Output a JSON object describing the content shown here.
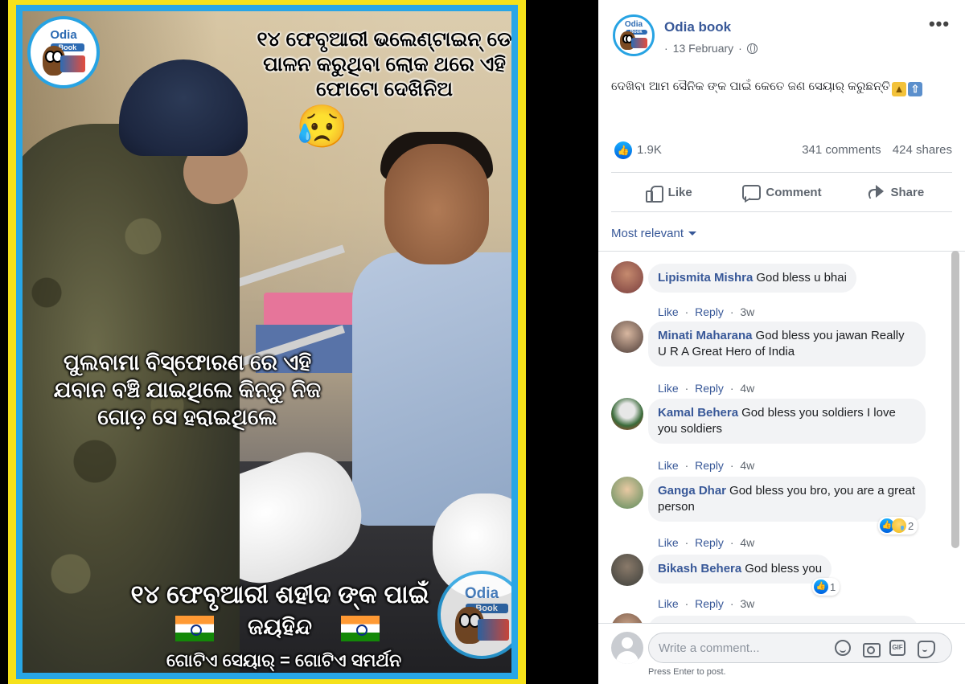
{
  "photo": {
    "top_text": "୧୪ ଫେବୃଆରୀ ଭଲେଣ୍ଟାଇନ୍ ଡେ ପାଳନ କରୁଥିବା ଲୋକ ଥରେ ଏହି ଫୋଟୋ ଦେଖିନିଅ",
    "emoji": "😥",
    "middle_text": "ପୁଲବାମା ବିସ୍ଫୋରଣ ରେ ଏହି ଯବାନ ବଞ୍ଚି ଯାଇଥିଲେ କିନ୍ତୁ ନିଜ ଗୋଡ଼ ସେ ହରାଇଥିଲେ",
    "bottom_line1": "୧୪ ଫେବୃଆରୀ ଶହୀଦ ଙ୍କ ପାଇଁ",
    "bottom_line2": "ଜୟହିନ୍ଦ",
    "bottom_line3": "ଗୋଟିଏ ସେୟାର୍ = ଗୋଟିଏ ସମର୍ଥନ",
    "logo_title": "Odia",
    "logo_sub": "Book",
    "colors": {
      "outer_border": "#f5e11a",
      "inner_border": "#28a6e6"
    }
  },
  "post": {
    "page_name": "Odia book",
    "date": "13 February",
    "separator": "·",
    "text": "ଦେଖିବା ଆମ ସୈନିକ ଙ୍କ ପାଇଁ କେତେ ଜଣ ସେୟାର୍ କରୁଛନ୍ତି",
    "text_emojis": [
      "thumbs-up",
      "up-arrow"
    ],
    "more_label": "•••",
    "likes": "1.9K",
    "comments_count": "341 comments",
    "shares_count": "424 shares"
  },
  "actions": {
    "like": "Like",
    "comment": "Comment",
    "share": "Share"
  },
  "sort": {
    "label": "Most relevant"
  },
  "comments": [
    {
      "author": "Lipismita Mishra",
      "text": "God bless u bhai",
      "like": "Like",
      "reply": "Reply",
      "time": "3w"
    },
    {
      "author": "Minati Maharana",
      "text": "God bless you jawan Really U R A Great Hero of India",
      "like": "Like",
      "reply": "Reply",
      "time": "4w"
    },
    {
      "author": "Kamal Behera",
      "text": "God bless you soldiers I love you soldiers",
      "like": "Like",
      "reply": "Reply",
      "time": "4w"
    },
    {
      "author": "Ganga Dhar",
      "text": "God bless you bro, you are a great person",
      "like": "Like",
      "reply": "Reply",
      "time": "4w",
      "reactions": "2"
    },
    {
      "author": "Bikash Behera",
      "text": "God bless you",
      "like": "Like",
      "reply": "Reply",
      "time": "3w",
      "reactions": "1"
    }
  ],
  "composer": {
    "placeholder": "Write a comment...",
    "hint": "Press Enter to post.",
    "gif_label": "GIF"
  },
  "colors": {
    "link": "#385898",
    "like_blue": "#1877f2",
    "bubble": "#f2f3f5"
  }
}
